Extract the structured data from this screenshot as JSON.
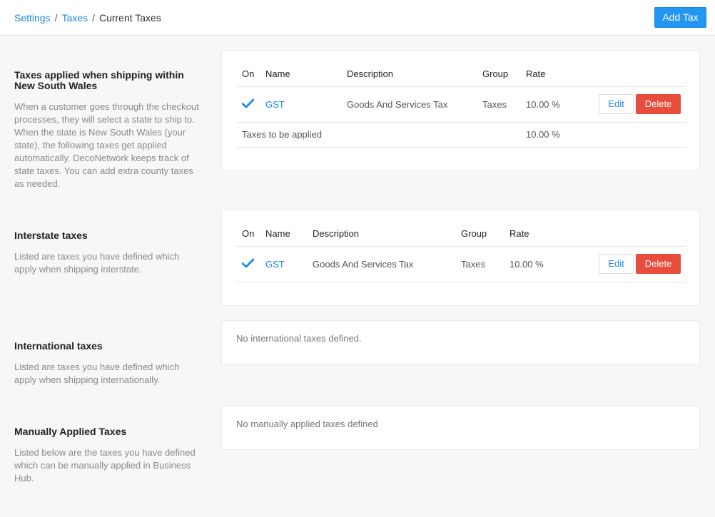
{
  "breadcrumb": {
    "settings": "Settings",
    "taxes": "Taxes",
    "current": "Current Taxes",
    "separator": "/"
  },
  "header": {
    "add_tax_label": "Add Tax"
  },
  "sections": {
    "state": {
      "title": "Taxes applied when shipping within New South Wales",
      "description": "When a customer goes through the checkout processes, they will select a state to ship to. When the state is New South Wales (your state), the following taxes get applied automatically. DecoNetwork keeps track of state taxes. You can add extra county taxes as needed.",
      "columns": {
        "on": "On",
        "name": "Name",
        "description": "Description",
        "group": "Group",
        "rate": "Rate"
      },
      "rows": [
        {
          "on": true,
          "name": "GST",
          "description": "Goods And Services Tax",
          "group": "Taxes",
          "rate": "10.00 %",
          "edit": "Edit",
          "delete": "Delete"
        }
      ],
      "total": {
        "label": "Taxes to be applied",
        "rate": "10.00 %"
      }
    },
    "interstate": {
      "title": "Interstate taxes",
      "description": "Listed are taxes you have defined which apply when shipping interstate.",
      "columns": {
        "on": "On",
        "name": "Name",
        "description": "Description",
        "group": "Group",
        "rate": "Rate"
      },
      "rows": [
        {
          "on": true,
          "name": "GST",
          "description": "Goods And Services Tax",
          "group": "Taxes",
          "rate": "10.00 %",
          "edit": "Edit",
          "delete": "Delete"
        }
      ]
    },
    "international": {
      "title": "International taxes",
      "description": "Listed are taxes you have defined which apply when shipping internationally.",
      "empty_message": "No international taxes defined."
    },
    "manual": {
      "title": "Manually Applied Taxes",
      "description": "Listed below are the taxes you have defined which can be manually applied in Business Hub.",
      "empty_message": "No manually applied taxes defined"
    }
  },
  "icons": {
    "enabled": "checkmark-icon"
  },
  "colors": {
    "accent": "#2196f3",
    "link": "#1e88e5",
    "danger": "#e74c3c"
  }
}
